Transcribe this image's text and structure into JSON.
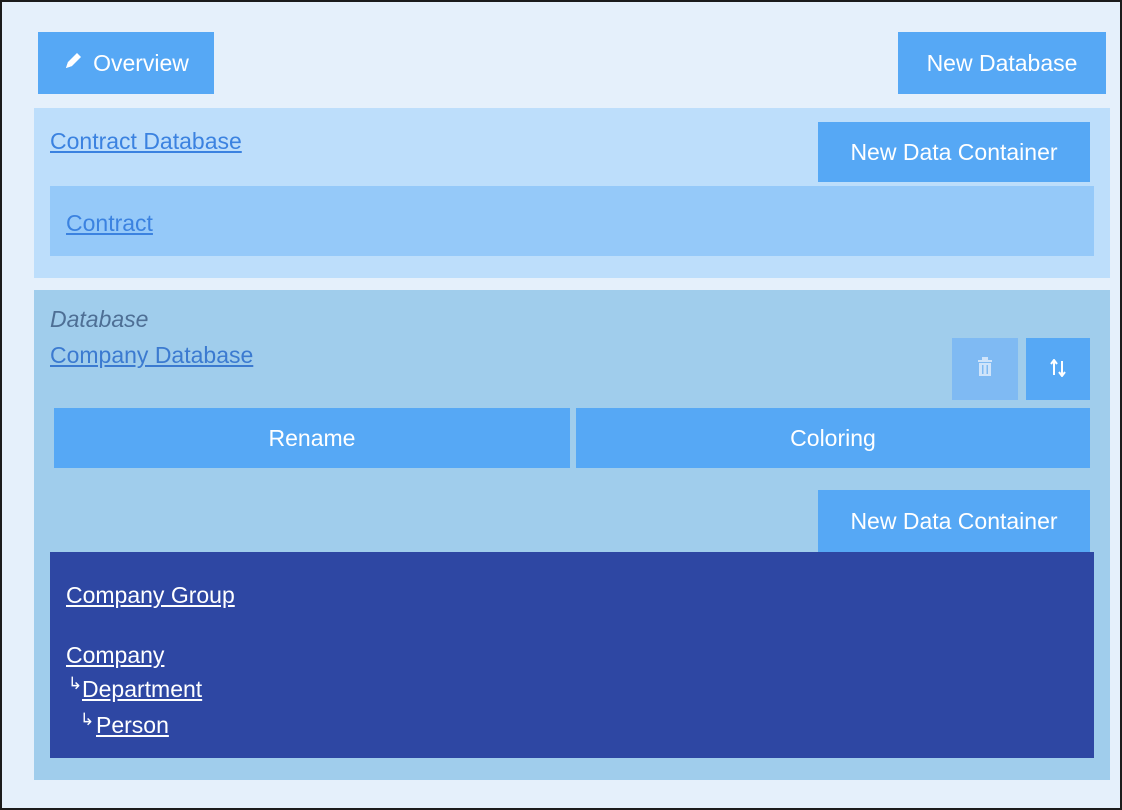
{
  "toolbar": {
    "overview_label": "Overview",
    "new_database_label": "New Database"
  },
  "databases": [
    {
      "name": "Contract Database",
      "new_container_label": "New Data Container",
      "containers": [
        "Contract"
      ]
    },
    {
      "caption": "Database",
      "name": "Company Database",
      "rename_label": "Rename",
      "coloring_label": "Coloring",
      "new_container_label": "New Data Container",
      "containers": {
        "group": "Company Group",
        "tree": [
          "Company",
          "Department",
          "Person"
        ]
      }
    }
  ],
  "icons": {
    "overview": "pencil-icon",
    "delete": "trash-icon",
    "sort": "sort-arrows-icon"
  },
  "colors": {
    "background": "#e5f0fb",
    "button": "#56a8f5",
    "panel_contract": "#bddefb",
    "container_contract": "#95c9f9",
    "panel_company": "#a0cdec",
    "container_company": "#2e47a3",
    "link": "#3b82e0"
  }
}
